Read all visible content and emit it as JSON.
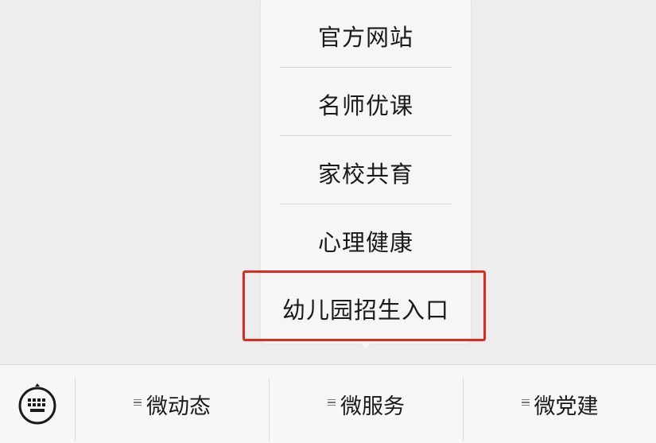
{
  "submenu": {
    "items": [
      {
        "label": "官方网站"
      },
      {
        "label": "名师优课"
      },
      {
        "label": "家校共育"
      },
      {
        "label": "心理健康"
      },
      {
        "label": "幼儿园招生入口"
      }
    ]
  },
  "bottom_bar": {
    "keyboard_icon": "keyboard-icon",
    "menus": [
      {
        "label": "微动态",
        "icon": "menu-lines-icon"
      },
      {
        "label": "微服务",
        "icon": "menu-lines-icon"
      },
      {
        "label": "微党建",
        "icon": "menu-lines-icon"
      }
    ]
  },
  "colors": {
    "highlight": "#e02a1f",
    "background": "#ededed",
    "menu_bg": "#f6f6f6"
  }
}
